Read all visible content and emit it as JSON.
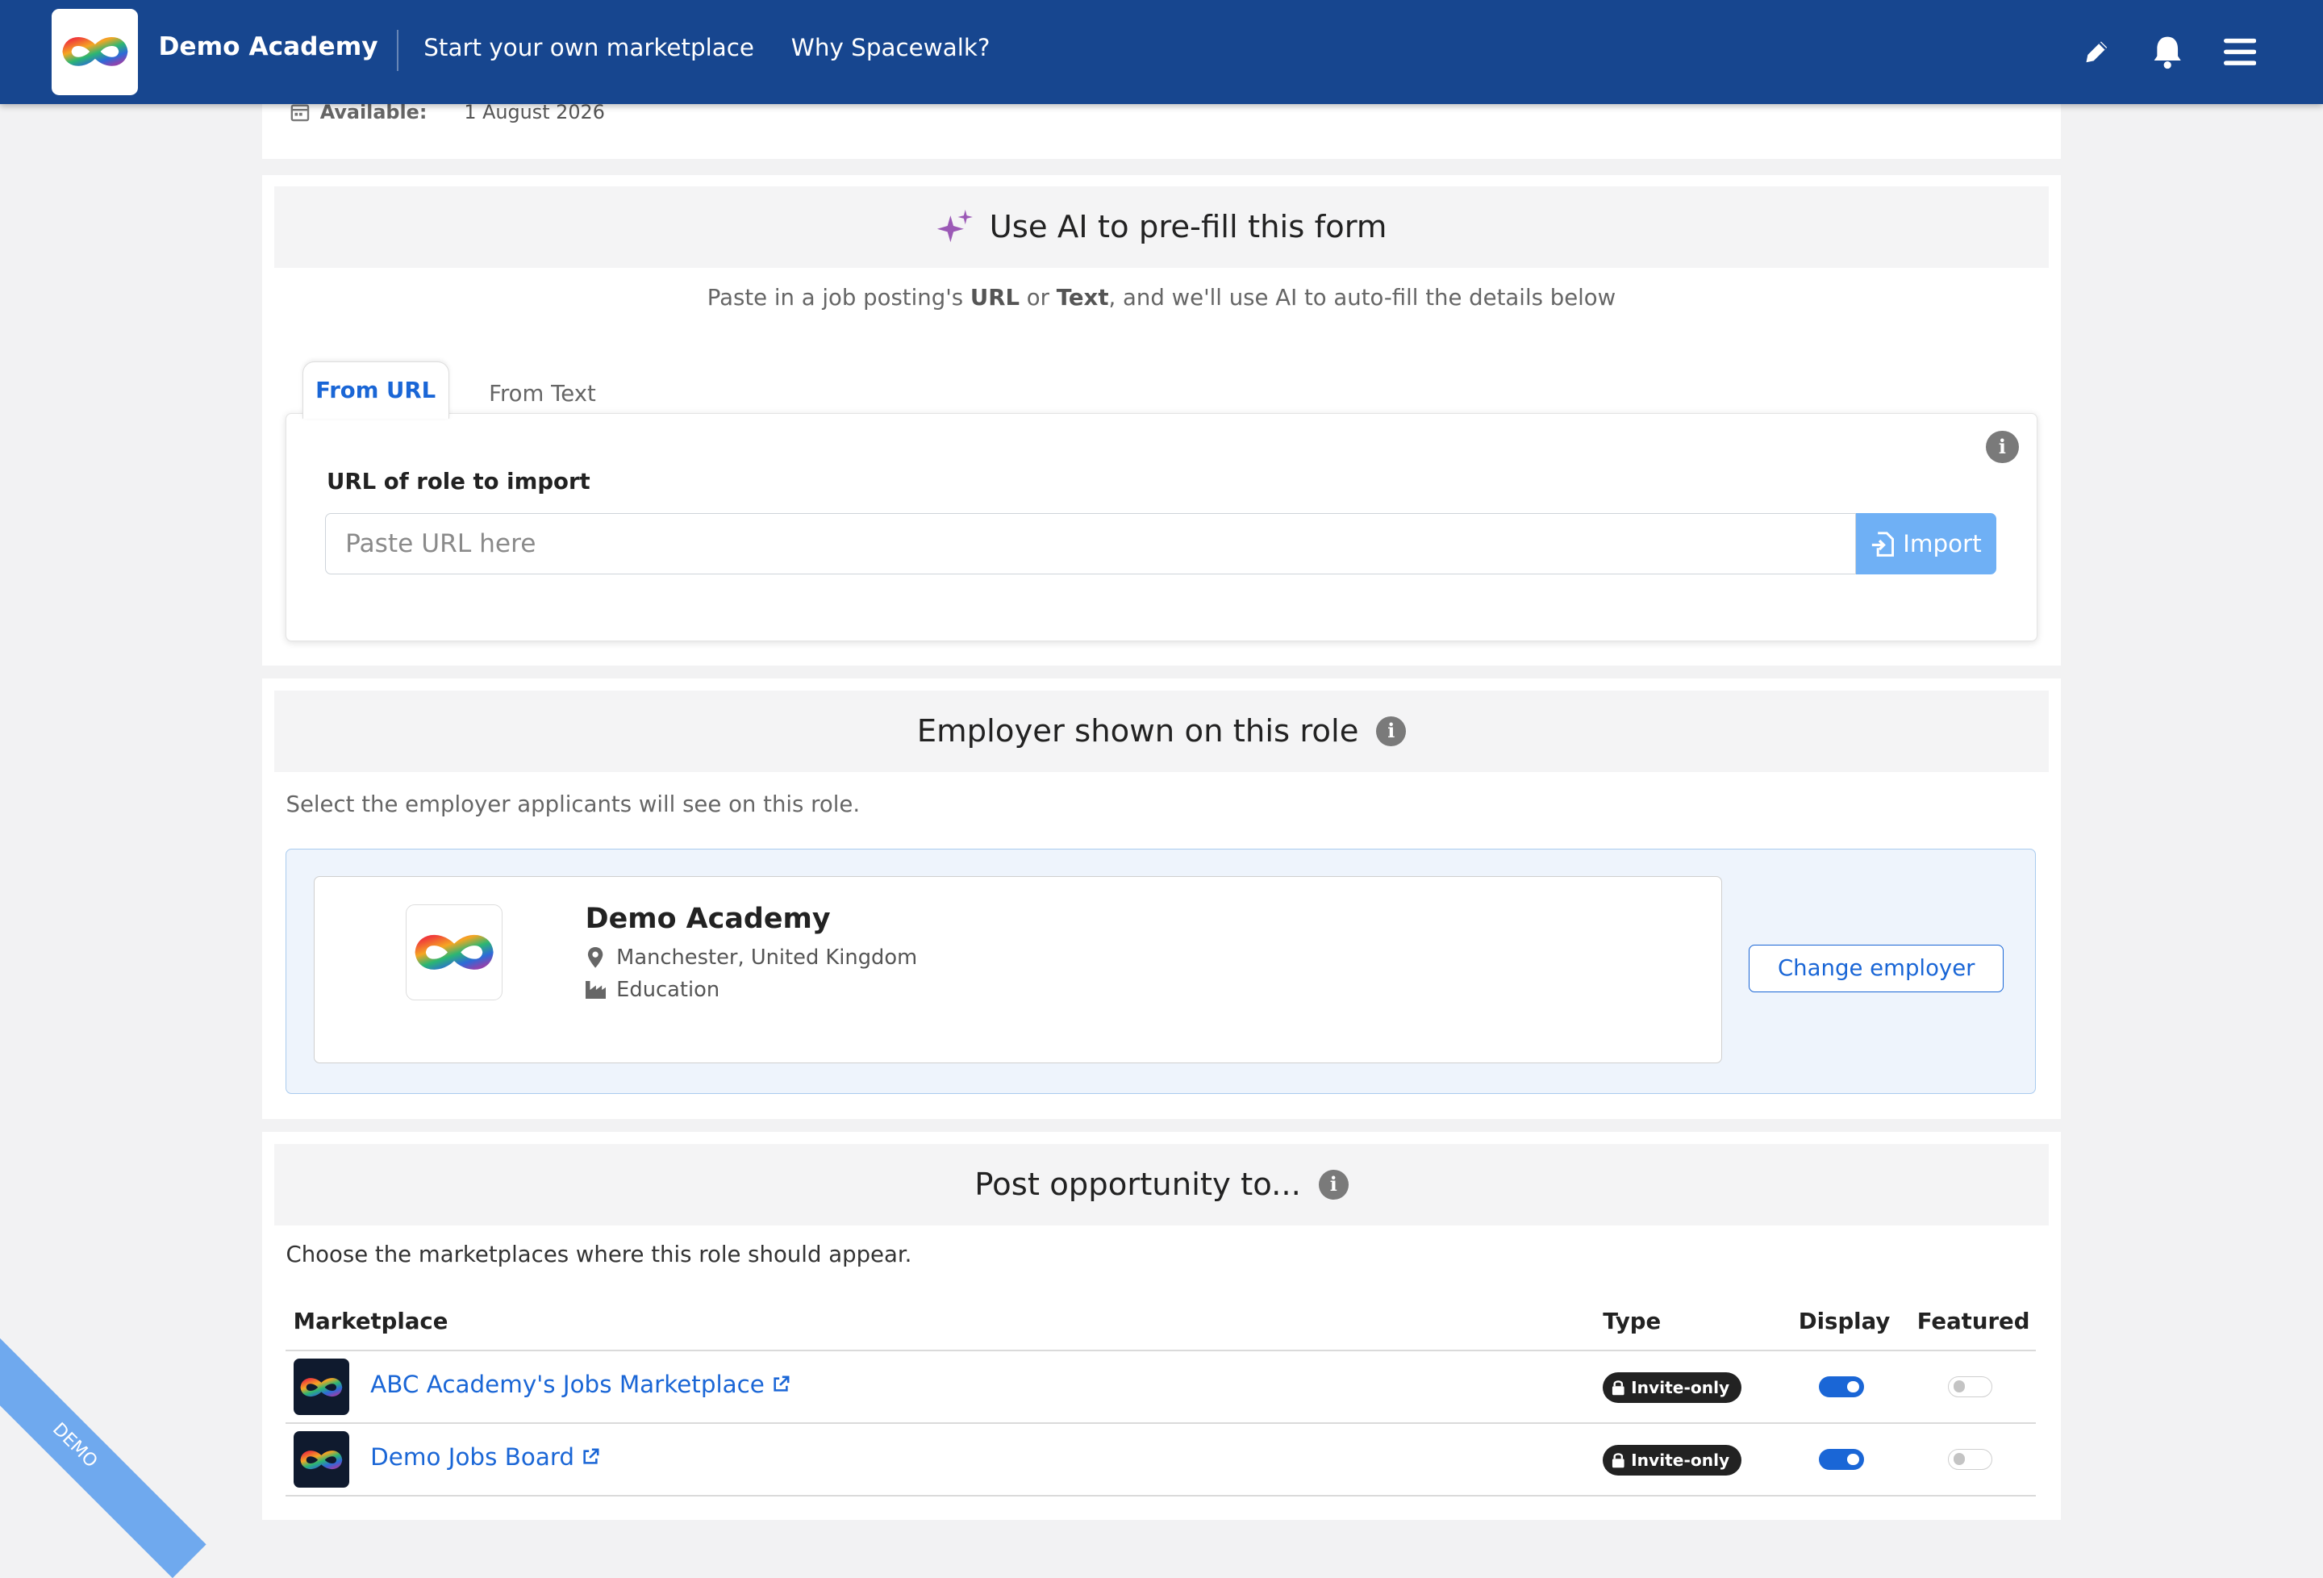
{
  "colors": {
    "nav_bg": "#17468f",
    "accent": "#1a66d6",
    "import_button": "#6fb0f5",
    "employer_box_bg": "#eef4fc"
  },
  "nav": {
    "brand": "Demo Academy",
    "links": [
      "Start your own marketplace",
      "Why Spacewalk?"
    ],
    "icons": [
      "pencil-icon",
      "bell-icon",
      "hamburger-menu-icon"
    ]
  },
  "availability": {
    "label": "Available:",
    "value": "1 August 2026"
  },
  "ai": {
    "title": "Use AI to pre-fill this form",
    "desc_pre": "Paste in a job posting's ",
    "desc_url": "URL",
    "desc_or": " or ",
    "desc_text": "Text",
    "desc_post": ", and we'll use AI to auto-fill the details below",
    "tabs": [
      "From URL",
      "From Text"
    ],
    "active_tab": "From URL",
    "url_label": "URL of role to import",
    "url_placeholder": "Paste URL here",
    "url_value": "",
    "import_label": "Import"
  },
  "employer": {
    "title": "Employer shown on this role",
    "desc": "Select the employer applicants will see on this role.",
    "name": "Demo Academy",
    "location": "Manchester, United Kingdom",
    "industry": "Education",
    "change_label": "Change employer"
  },
  "marketplaces": {
    "title": "Post opportunity to...",
    "desc": "Choose the marketplaces where this role should appear.",
    "columns": [
      "Marketplace",
      "Type",
      "Display",
      "Featured"
    ],
    "rows": [
      {
        "name": "ABC Academy's Jobs Marketplace",
        "type": "Invite-only",
        "display": true,
        "featured": false
      },
      {
        "name": "Demo Jobs Board",
        "type": "Invite-only",
        "display": true,
        "featured": false
      }
    ]
  },
  "ribbon": "DEMO"
}
